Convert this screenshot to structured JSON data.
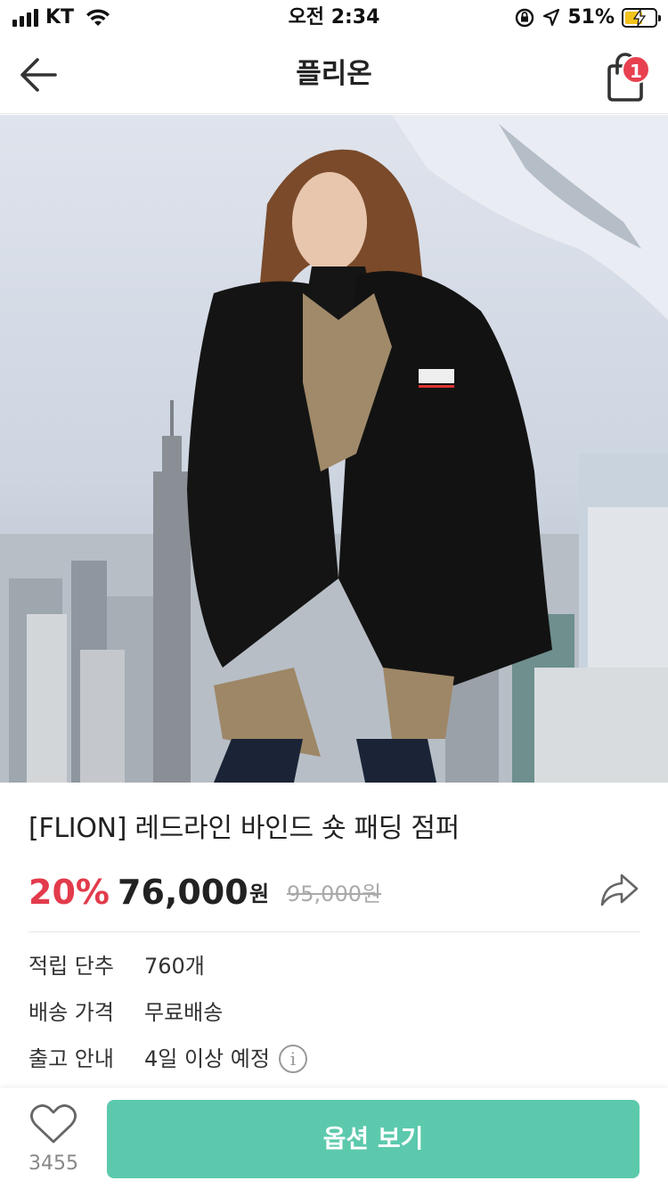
{
  "status_bar": {
    "carrier": "KT",
    "time": "오전 2:34",
    "battery_pct": "51%",
    "battery_level": 0.51,
    "icons": [
      "signal-icon",
      "wifi-icon",
      "rotation-lock-icon",
      "location-icon",
      "battery-icon"
    ]
  },
  "header": {
    "title": "플리온",
    "cart_badge": "1"
  },
  "product": {
    "title": "[FLION] 레드라인 바인드 숏 패딩 점퍼",
    "discount": "20%",
    "price": "76,000",
    "price_unit": "원",
    "original_price": "95,000원"
  },
  "info": [
    {
      "label": "적립 단추",
      "value": "760개"
    },
    {
      "label": "배송 가격",
      "value": "무료배송"
    },
    {
      "label": "출고 안내",
      "value": "4일 이상 예정"
    }
  ],
  "bottom_bar": {
    "like_count": "3455",
    "option_button": "옵션 보기"
  },
  "colors": {
    "accent": "#5cc9ad",
    "discount": "#e23b4c",
    "badge": "#e8404f"
  }
}
